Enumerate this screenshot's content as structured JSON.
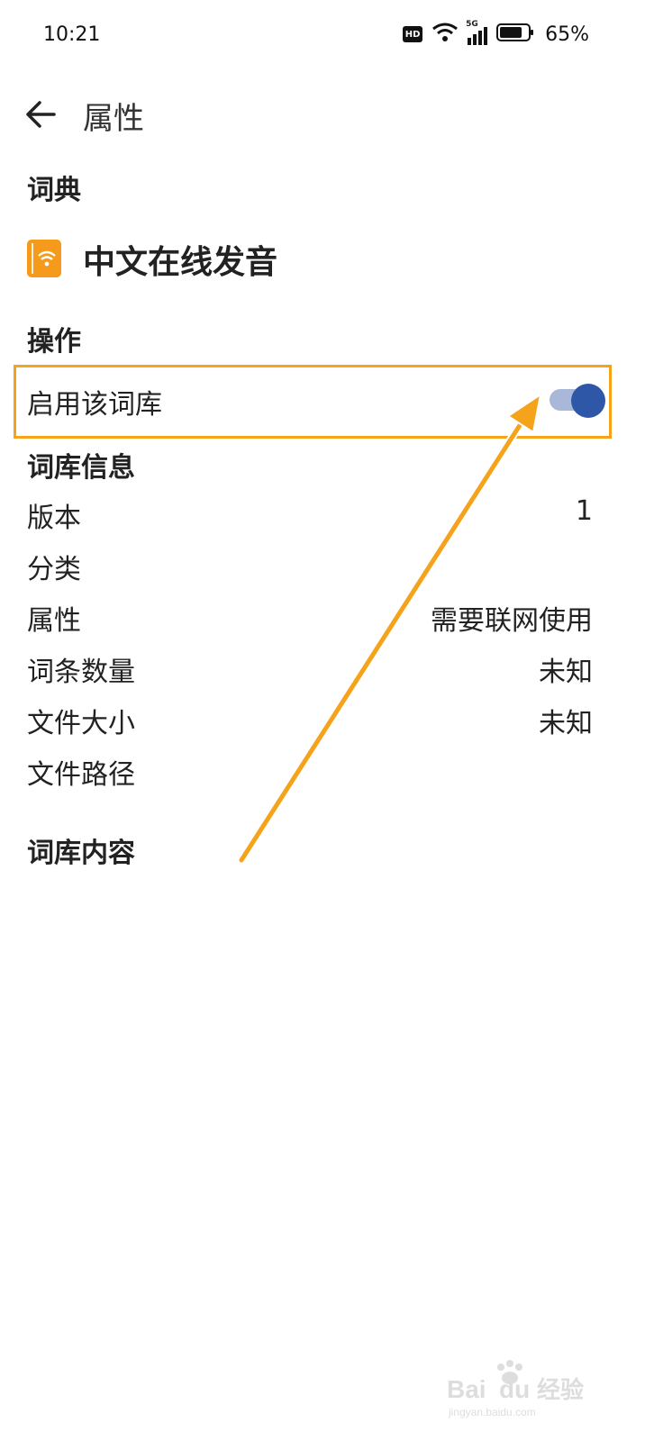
{
  "status_bar": {
    "time": "10:21",
    "hd_badge": "HD",
    "network": "5G",
    "battery_percent": "65%",
    "icons": [
      "wifi-icon",
      "signal-icon",
      "battery-icon"
    ]
  },
  "app_bar": {
    "title": "属性",
    "back_icon": "back-arrow-icon"
  },
  "dictionary_section": {
    "header": "词典",
    "name": "中文在线发音",
    "icon": "online-dictionary-icon",
    "icon_color": "#f59a1b"
  },
  "operations_section": {
    "header": "操作",
    "enable_label": "启用该词库",
    "enable_toggle_on": true,
    "toggle_color": "#2e57a8"
  },
  "info_section": {
    "header": "词库信息",
    "rows": [
      {
        "label": "版本",
        "value": "1"
      },
      {
        "label": "分类",
        "value": ""
      },
      {
        "label": "属性",
        "value": "需要联网使用"
      },
      {
        "label": "词条数量",
        "value": "未知"
      },
      {
        "label": "文件大小",
        "value": "未知"
      },
      {
        "label": "文件路径",
        "value": ""
      }
    ]
  },
  "content_section": {
    "header": "词库内容"
  },
  "annotation": {
    "color": "#f5a31b"
  },
  "watermark": {
    "text": "Bai du 经验",
    "subtext": "jingyan.baidu.com"
  }
}
